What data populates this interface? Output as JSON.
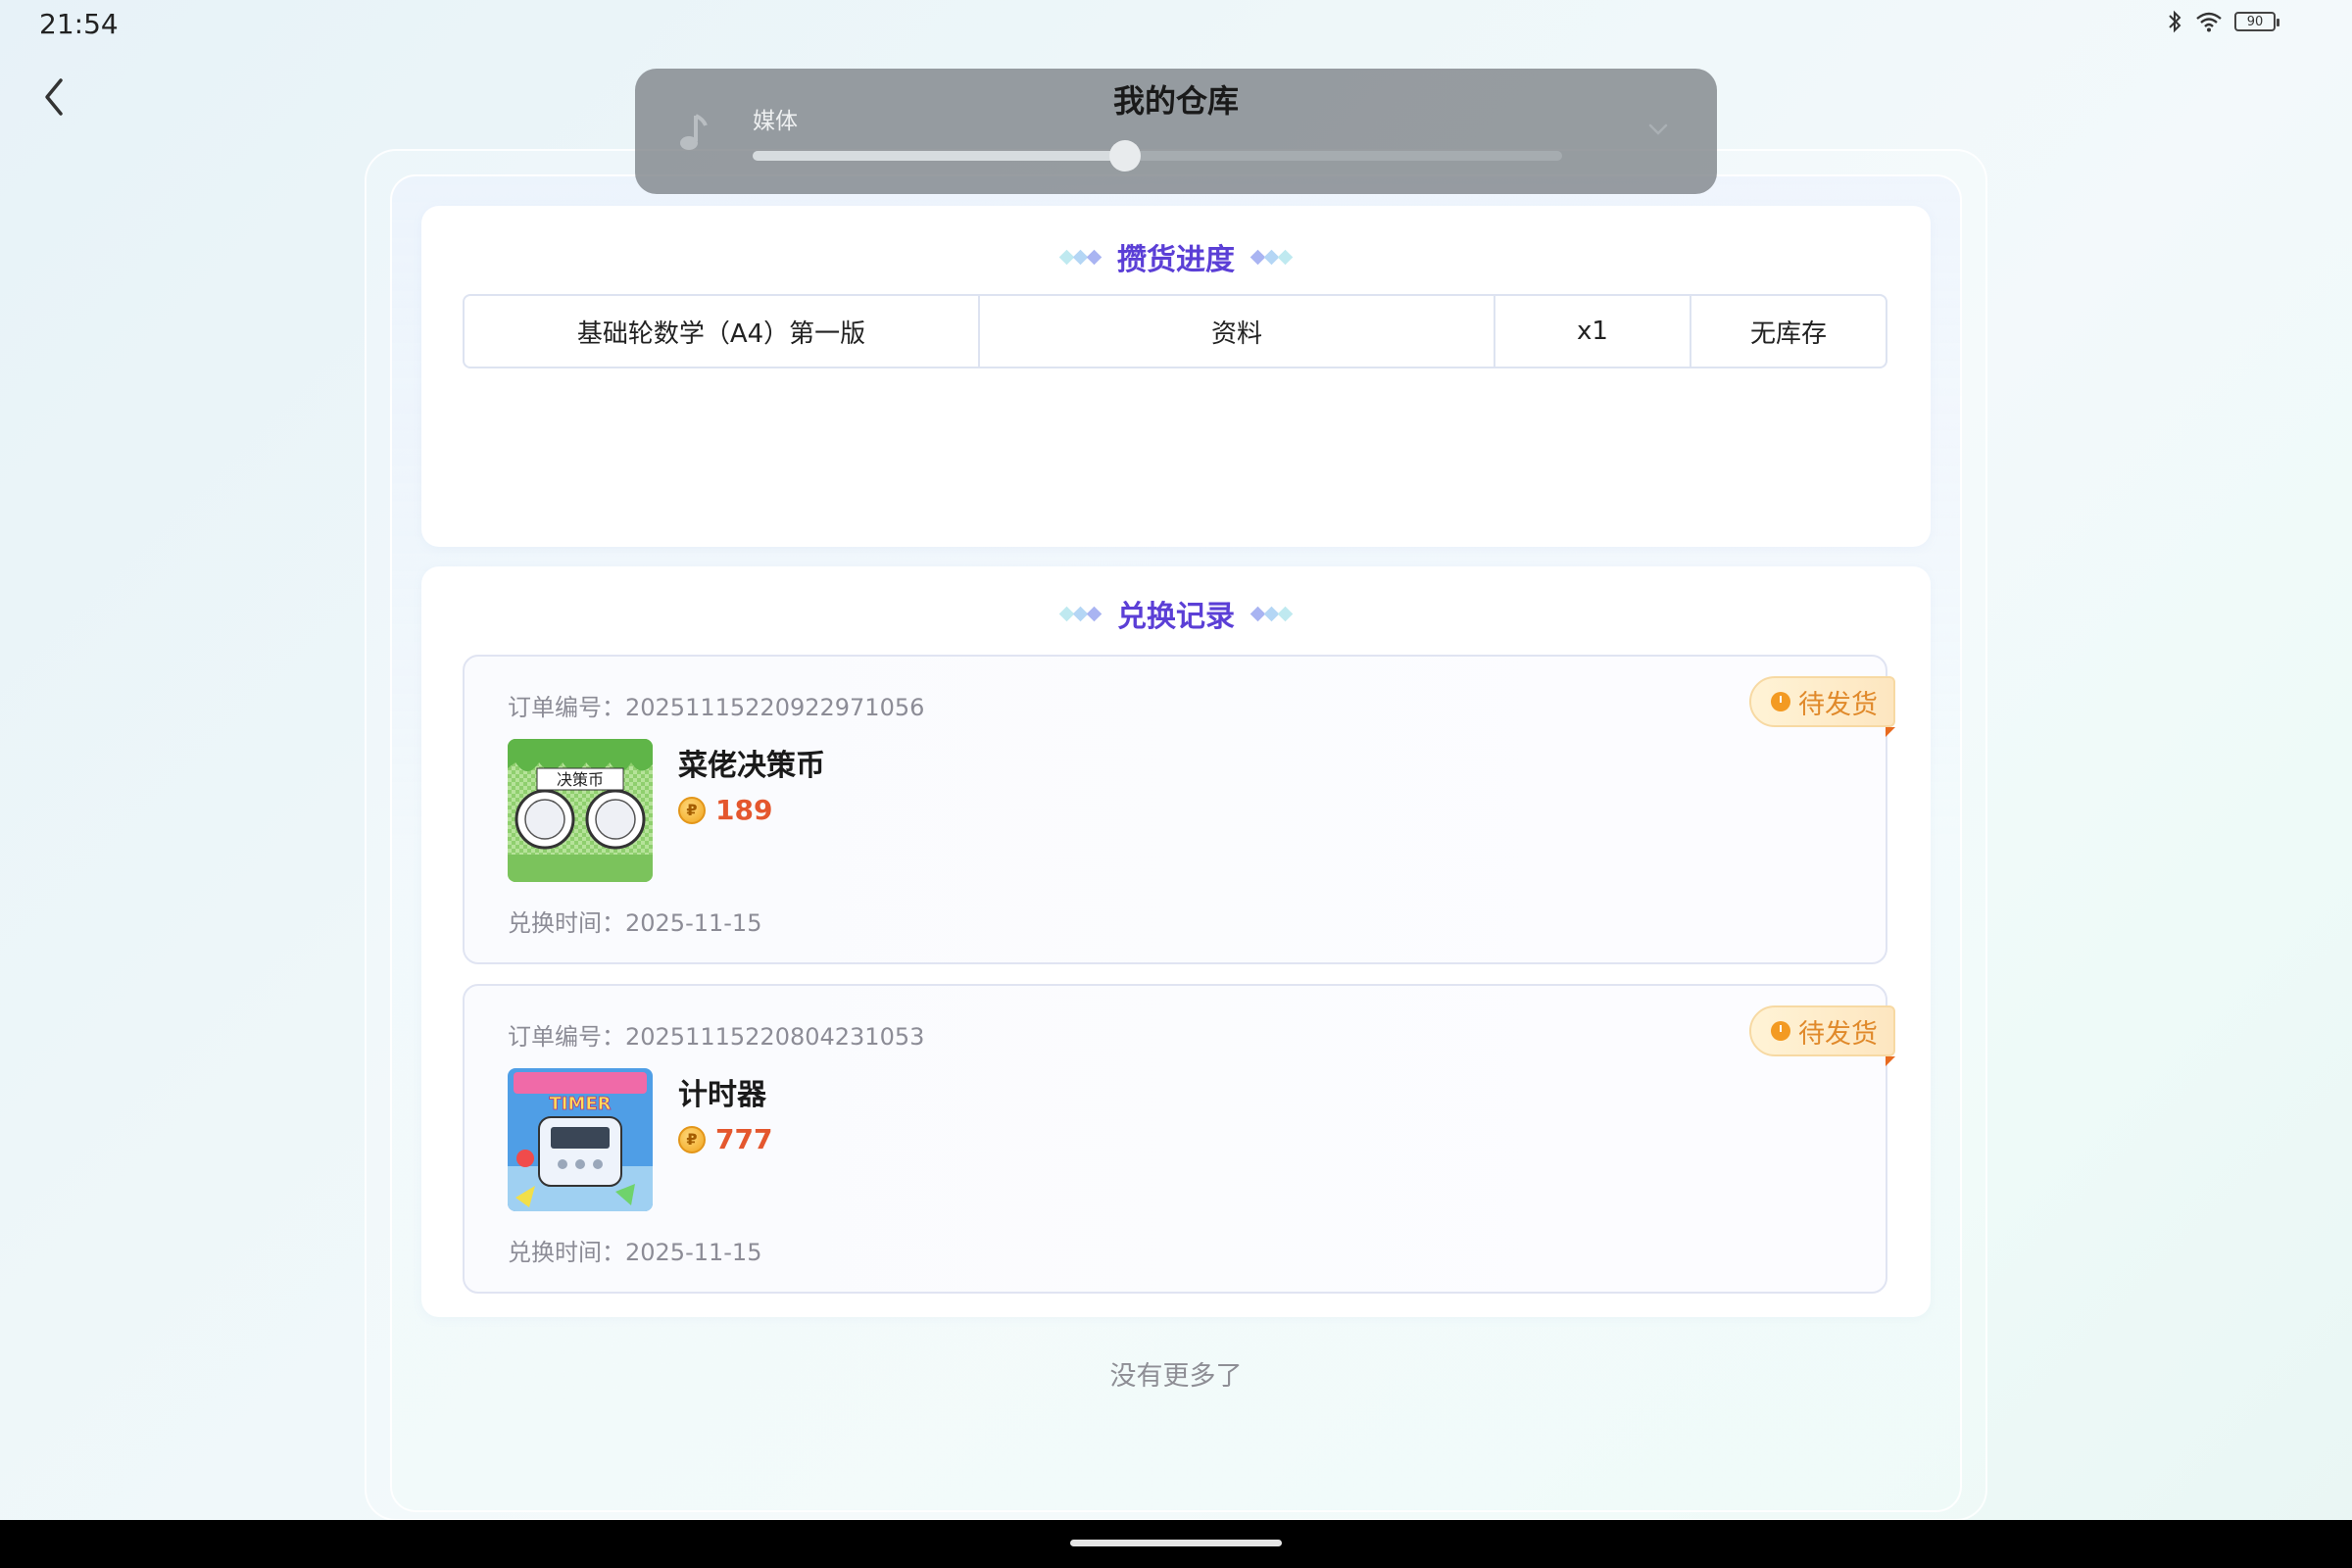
{
  "status_bar": {
    "time": "21:54",
    "battery": "90",
    "bluetooth_icon": "bluetooth-icon",
    "wifi_icon": "wifi-icon"
  },
  "header": {
    "title": "我的仓库",
    "back_icon": "chevron-left-icon"
  },
  "volume_overlay": {
    "label": "媒体",
    "level_fraction": 0.46,
    "icon": "music-note-icon",
    "expand_icon": "chevron-down-icon"
  },
  "stock_section": {
    "title": "攒货进度",
    "row": {
      "name": "基础轮数学（A4）第一版",
      "category": "资料",
      "quantity": "x1",
      "status": "无库存"
    }
  },
  "records_section": {
    "title": "兑换记录",
    "orders": [
      {
        "order_no": "订单编号：20251115220922971056",
        "name": "菜佬决策币",
        "price": "189",
        "time": "兑换时间：2025-11-15",
        "status": "待发货",
        "image_label": "决策币"
      },
      {
        "order_no": "订单编号：20251115220804231053",
        "name": "计时器",
        "price": "777",
        "time": "兑换时间：2025-11-15",
        "status": "待发货",
        "image_label": "TIMER"
      }
    ]
  },
  "footer": {
    "no_more": "没有更多了"
  },
  "colors": {
    "accent_purple": "#5b3fd6",
    "price_red": "#e4572e",
    "badge_orange": "#e0892a"
  }
}
